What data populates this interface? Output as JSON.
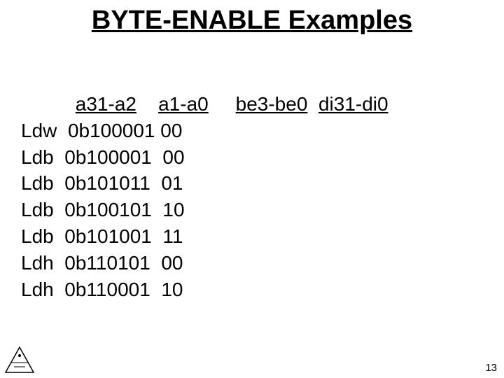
{
  "title": "BYTE-ENABLE Examples",
  "headers": {
    "col_a31_a2": "a31-a2",
    "col_a1_a0": "a1-a0",
    "col_be3_be0": "be3-be0",
    "col_di31_di0": "di31-di0"
  },
  "rows": [
    {
      "instr": "Ldw",
      "a31_a2": "0b100001",
      "a1_a0": "00",
      "be3_be0": "",
      "di31_di0": ""
    },
    {
      "instr": "Ldb",
      "a31_a2": "0b100001",
      "a1_a0": "00",
      "be3_be0": "",
      "di31_di0": ""
    },
    {
      "instr": "Ldb",
      "a31_a2": "0b101011",
      "a1_a0": "01",
      "be3_be0": "",
      "di31_di0": ""
    },
    {
      "instr": "Ldb",
      "a31_a2": "0b100101",
      "a1_a0": "10",
      "be3_be0": "",
      "di31_di0": ""
    },
    {
      "instr": "Ldb",
      "a31_a2": "0b101001",
      "a1_a0": "11",
      "be3_be0": "",
      "di31_di0": ""
    },
    {
      "instr": "Ldh",
      "a31_a2": "0b110101",
      "a1_a0": "00",
      "be3_be0": "",
      "di31_di0": ""
    },
    {
      "instr": "Ldh",
      "a31_a2": "0b110001",
      "a1_a0": "10",
      "be3_be0": "",
      "di31_di0": ""
    }
  ],
  "page_number": "13"
}
